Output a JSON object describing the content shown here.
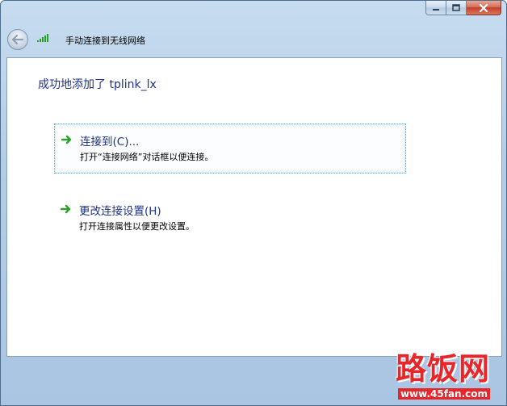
{
  "window": {
    "title_bar_buttons": {
      "minimize_icon": "minimize-icon",
      "maximize_icon": "maximize-icon",
      "close_icon": "close-icon"
    }
  },
  "nav": {
    "back_icon": "back-arrow-icon",
    "signal_icon": "wireless-signal-icon",
    "title": "手动连接到无线网络"
  },
  "main": {
    "heading": "成功地添加了 tplink_lx",
    "links": [
      {
        "title": "连接到(C)...",
        "description": "打开“连接网络”对话框以便连接。",
        "icon": "green-arrow-icon"
      },
      {
        "title": "更改连接设置(H)",
        "description": "打开连接属性以便更改设置。",
        "icon": "green-arrow-icon"
      }
    ]
  },
  "watermark": {
    "logo": "路饭网",
    "url": "www.45fan.com"
  },
  "colors": {
    "link_blue": "#1e3287",
    "arrow_green": "#2aa12a",
    "close_red": "#c2402b",
    "watermark_red": "#e8262a"
  }
}
